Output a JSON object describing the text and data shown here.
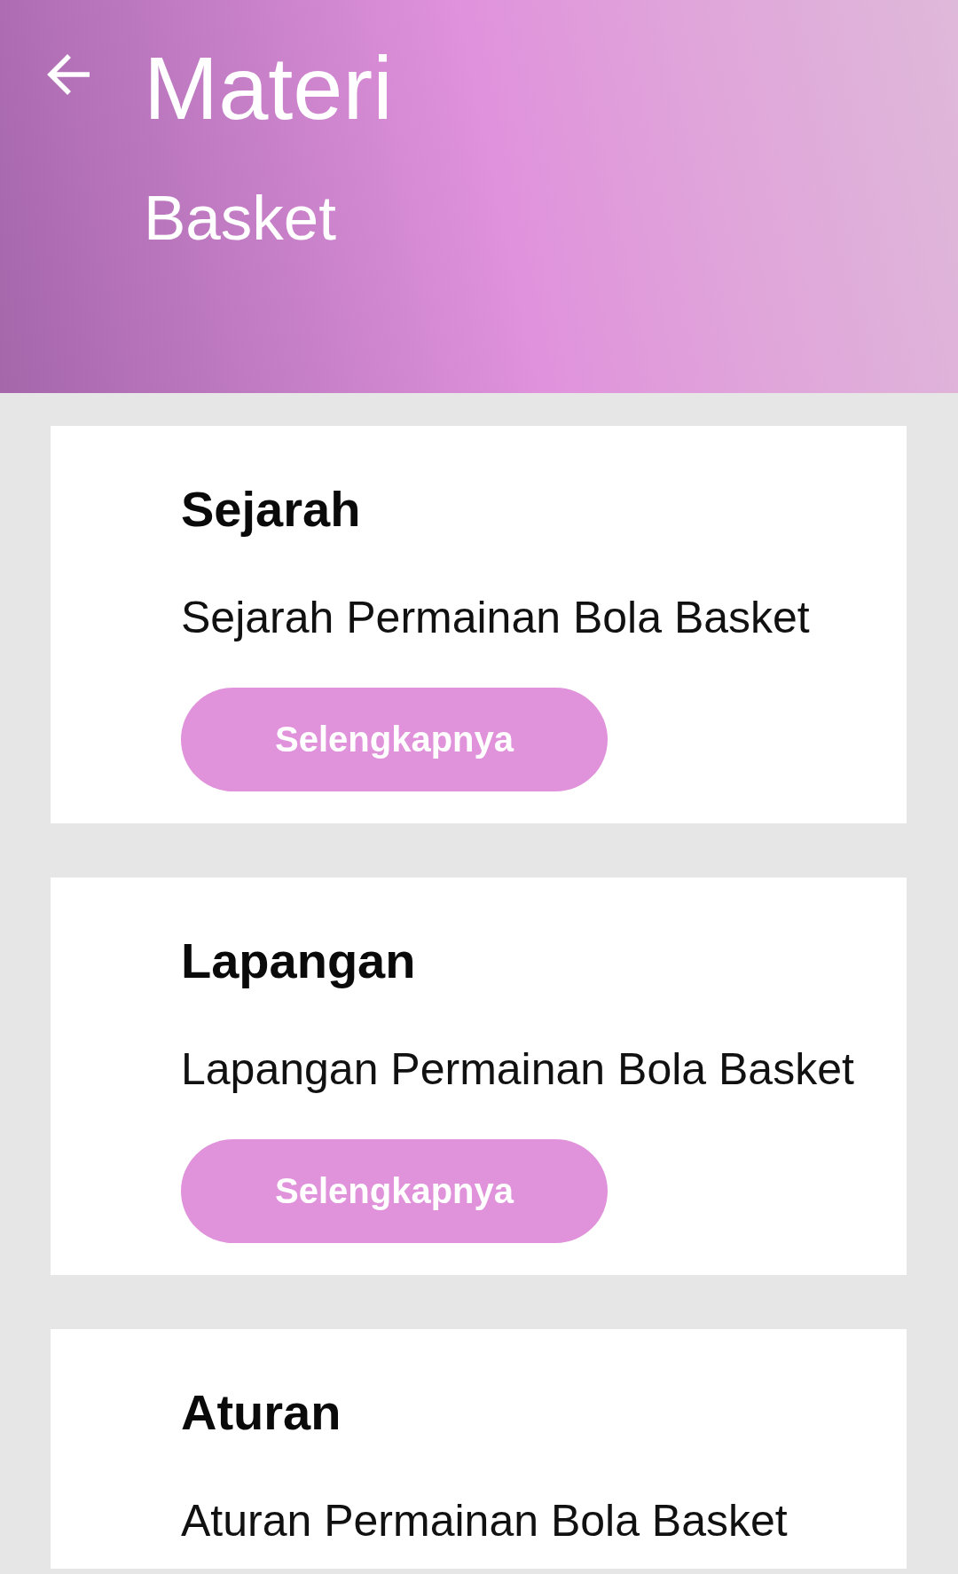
{
  "app_bar": {
    "title": "Materi",
    "subtitle": "Basket"
  },
  "cards": [
    {
      "title": "Sejarah",
      "description": "Sejarah Permainan Bola Basket",
      "button": "Selengkapnya"
    },
    {
      "title": "Lapangan",
      "description": "Lapangan Permainan Bola Basket",
      "button": "Selengkapnya"
    },
    {
      "title": "Aturan",
      "description": "Aturan Permainan Bola Basket"
    }
  ]
}
